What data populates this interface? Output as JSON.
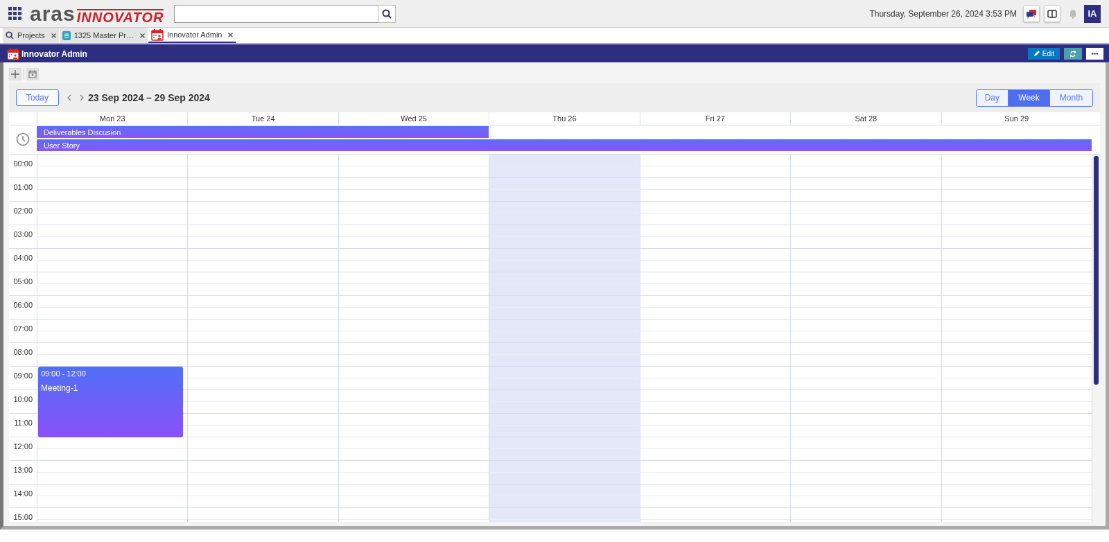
{
  "header": {
    "logo": {
      "word": "aras",
      "product": "INNOVATOR"
    },
    "datetime": "Thursday, September 26, 2024 3:53 PM",
    "avatar": "IA"
  },
  "tabs": [
    {
      "label": "Projects",
      "selected": false
    },
    {
      "label": "1325 Master Pr…",
      "selected": false
    },
    {
      "label": "Innovator Admin",
      "selected": true
    }
  ],
  "panel": {
    "title": "Innovator Admin",
    "edit_button": "Edit"
  },
  "calendar": {
    "today_button": "Today",
    "range": "23 Sep 2024 – 29 Sep 2024",
    "views": [
      {
        "label": "Day",
        "selected": false
      },
      {
        "label": "Week",
        "selected": true
      },
      {
        "label": "Month",
        "selected": false
      }
    ],
    "days": [
      {
        "label": "Mon 23",
        "today": false,
        "events": [
          {
            "time": "09:00 - 12:00",
            "title": "Meeting-1"
          }
        ]
      },
      {
        "label": "Tue 24",
        "today": false
      },
      {
        "label": "Wed 25",
        "today": false
      },
      {
        "label": "Thu 26",
        "today": true
      },
      {
        "label": "Fri 27",
        "today": false
      },
      {
        "label": "Sat 28",
        "today": false
      },
      {
        "label": "Sun 29",
        "today": false
      }
    ],
    "all_day": [
      {
        "title": "Deliverables Discusion",
        "days_covered": [
          true,
          true,
          true,
          false,
          false,
          false,
          false
        ]
      },
      {
        "title": "User Story",
        "days_covered": [
          true,
          true,
          true,
          true,
          true,
          true,
          true
        ]
      }
    ],
    "hours": [
      "00:00",
      "01:00",
      "02:00",
      "03:00",
      "04:00",
      "05:00",
      "06:00",
      "07:00",
      "08:00",
      "09:00",
      "10:00",
      "11:00",
      "12:00",
      "13:00",
      "14:00",
      "15:00"
    ]
  }
}
